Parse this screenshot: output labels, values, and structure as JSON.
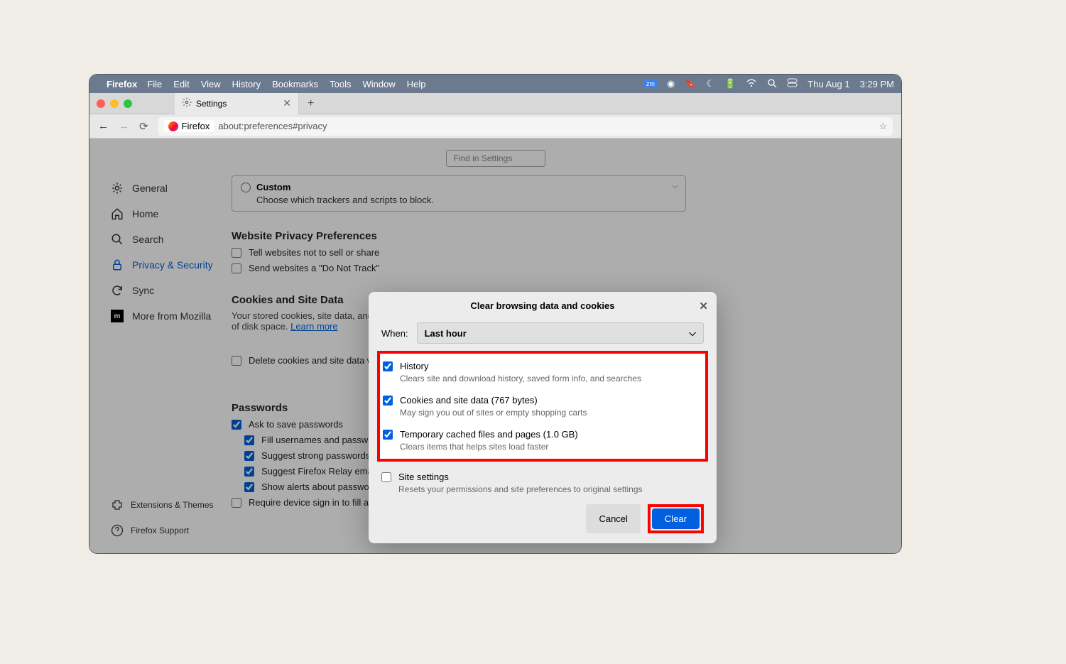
{
  "menubar": {
    "app": "Firefox",
    "items": [
      "File",
      "Edit",
      "View",
      "History",
      "Bookmarks",
      "Tools",
      "Window",
      "Help"
    ],
    "date": "Thu Aug 1",
    "time": "3:29 PM"
  },
  "tab": {
    "title": "Settings"
  },
  "urlbar": {
    "prefix": "Firefox",
    "url": "about:preferences#privacy"
  },
  "find_placeholder": "Find in Settings",
  "sidebar": {
    "general": "General",
    "home": "Home",
    "search": "Search",
    "privacy": "Privacy & Security",
    "sync": "Sync",
    "more": "More from Mozilla",
    "extensions": "Extensions & Themes",
    "support": "Firefox Support"
  },
  "settings": {
    "custom_title": "Custom",
    "custom_desc": "Choose which trackers and scripts to block.",
    "wpp_title": "Website Privacy Preferences",
    "wpp_tell": "Tell websites not to sell or share",
    "wpp_dnt": "Send websites a \"Do Not Track\"",
    "cookies_title": "Cookies and Site Data",
    "cookies_desc": "Your stored cookies, site data, and c",
    "cookies_desc2": "of disk space.",
    "learn_more": "Learn more",
    "delete_cookies": "Delete cookies and site data whe",
    "passwords_title": "Passwords",
    "ask_save": "Ask to save passwords",
    "fill_user": "Fill usernames and password",
    "suggest_strong": "Suggest strong passwords",
    "relay": "Suggest Firefox Relay email masks to protect your email address",
    "breached": "Show alerts about passwords for breached websites",
    "require_signin": "Require device sign in to fill and manage passwords"
  },
  "dialog": {
    "title": "Clear browsing data and cookies",
    "when_label": "When:",
    "when_value": "Last hour",
    "history_label": "History",
    "history_desc": "Clears site and download history, saved form info, and searches",
    "cookies_label": "Cookies and site data (767 bytes)",
    "cookies_desc": "May sign you out of sites or empty shopping carts",
    "cache_label": "Temporary cached files and pages (1.0 GB)",
    "cache_desc": "Clears items that helps sites load faster",
    "site_label": "Site settings",
    "site_desc": "Resets your permissions and site preferences to original settings",
    "cancel": "Cancel",
    "clear": "Clear"
  }
}
